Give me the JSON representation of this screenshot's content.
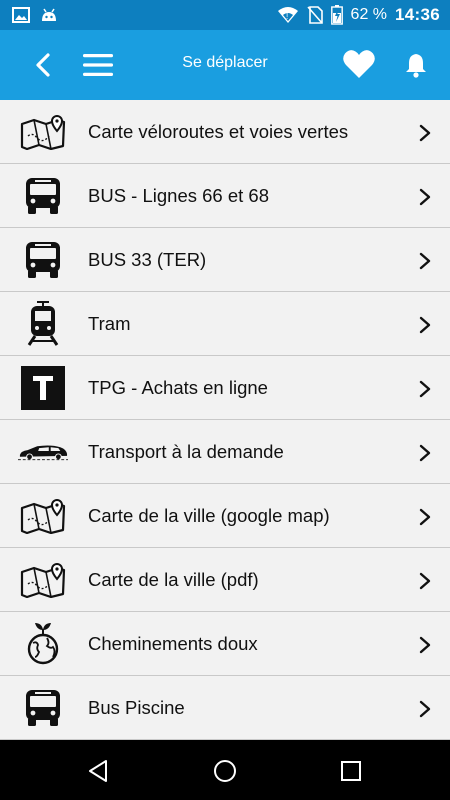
{
  "status_bar": {
    "battery": "62 %",
    "time": "14:36",
    "icons": [
      "image-icon",
      "android-icon",
      "wifi-icon",
      "no-sim-icon",
      "battery-icon"
    ]
  },
  "app_bar": {
    "title": "Se déplacer",
    "icons": [
      "back-icon",
      "hamburger-menu-icon",
      "heart-icon",
      "bell-icon"
    ]
  },
  "items": [
    {
      "label": "Carte véloroutes et voies vertes",
      "icon": "map-pin-icon"
    },
    {
      "label": "BUS - Lignes 66 et 68",
      "icon": "bus-icon"
    },
    {
      "label": "BUS 33 (TER)",
      "icon": "bus-icon"
    },
    {
      "label": "Tram",
      "icon": "tram-icon"
    },
    {
      "label": "TPG - Achats en ligne",
      "icon": "tpg-t-icon"
    },
    {
      "label": "Transport à la demande",
      "icon": "van-icon"
    },
    {
      "label": "Carte de la ville (google map)",
      "icon": "map-pin-icon"
    },
    {
      "label": "Carte de la ville (pdf)",
      "icon": "map-pin-icon"
    },
    {
      "label": "Cheminements doux",
      "icon": "eco-globe-icon"
    },
    {
      "label": "Bus Piscine",
      "icon": "bus-icon"
    }
  ],
  "nav_bar": [
    "nav-back-icon",
    "nav-home-icon",
    "nav-recents-icon"
  ],
  "colors": {
    "status_bar": "#0d7fbf",
    "app_bar": "#1a9ee0",
    "background": "#f2f2f2"
  }
}
